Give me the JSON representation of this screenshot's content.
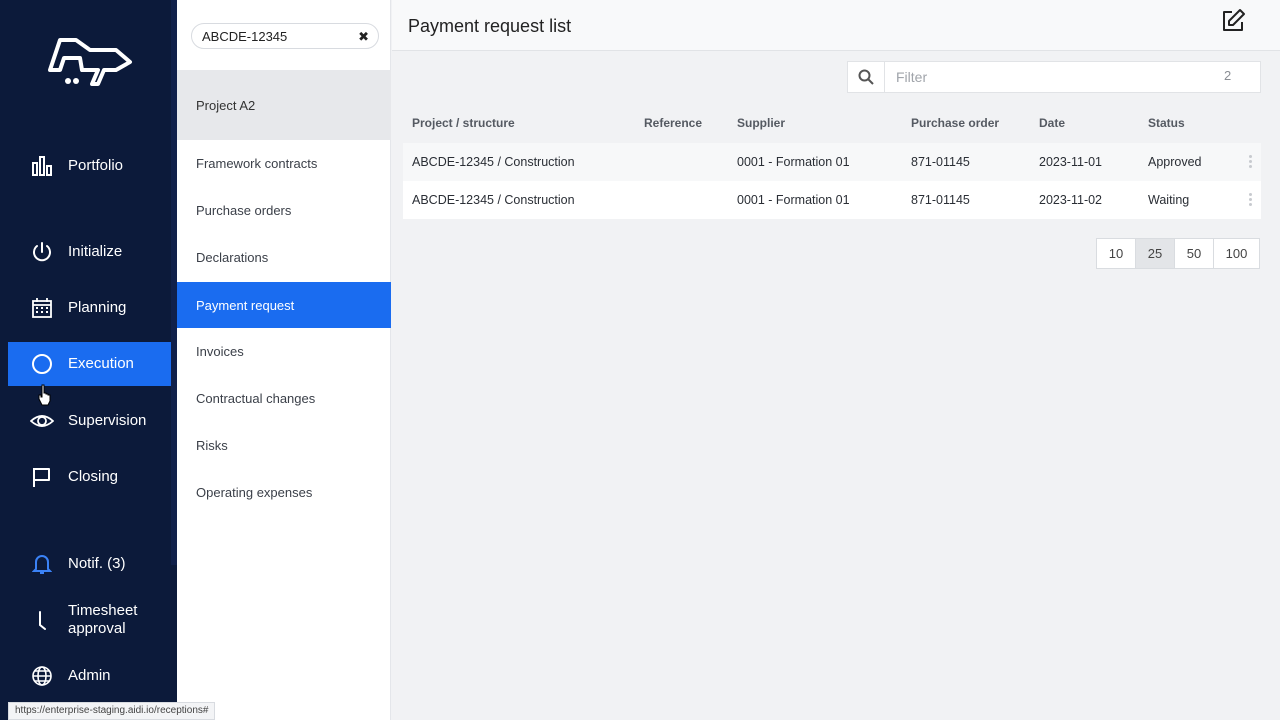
{
  "nav": {
    "items": [
      {
        "label": "Portfolio",
        "icon": "bar-chart-icon"
      },
      {
        "label": "Initialize",
        "icon": "power-icon"
      },
      {
        "label": "Planning",
        "icon": "calendar-icon"
      },
      {
        "label": "Execution",
        "icon": "spinner-circle-icon",
        "active": true
      },
      {
        "label": "Supervision",
        "icon": "eye-icon"
      },
      {
        "label": "Closing",
        "icon": "flag-icon"
      },
      {
        "label": "Notif. (3)",
        "icon": "bell-icon"
      },
      {
        "label": "Timesheet approval",
        "icon": "clock-hand-icon"
      },
      {
        "label": "Admin",
        "icon": "globe-icon"
      }
    ]
  },
  "submenu": {
    "search_value": "ABCDE-12345",
    "project": "Project A2",
    "items": [
      {
        "label": "Framework contracts"
      },
      {
        "label": "Purchase orders"
      },
      {
        "label": "Declarations"
      },
      {
        "label": "Payment request",
        "active": true
      },
      {
        "label": "Invoices"
      },
      {
        "label": "Contractual changes"
      },
      {
        "label": "Risks"
      },
      {
        "label": "Operating expenses"
      }
    ]
  },
  "main": {
    "title": "Payment request list",
    "filter_placeholder": "Filter",
    "filter_count": "2",
    "columns": [
      "Project / structure",
      "Reference",
      "Supplier",
      "Purchase order",
      "Date",
      "Status"
    ],
    "rows": [
      [
        "ABCDE-12345 / Construction",
        "",
        "0001 - Formation 01",
        "871-01145",
        "2023-11-01",
        "Approved"
      ],
      [
        "ABCDE-12345 / Construction",
        "",
        "0001 - Formation 01",
        "871-01145",
        "2023-11-02",
        "Waiting"
      ]
    ],
    "page_sizes": [
      "10",
      "25",
      "50",
      "100"
    ],
    "active_page_size": "25"
  },
  "statusbar": {
    "url": "https://enterprise-staging.aidi.io/receptions#"
  },
  "colors": {
    "nav_bg": "#0c1a3a",
    "accent": "#1a6cf0"
  }
}
